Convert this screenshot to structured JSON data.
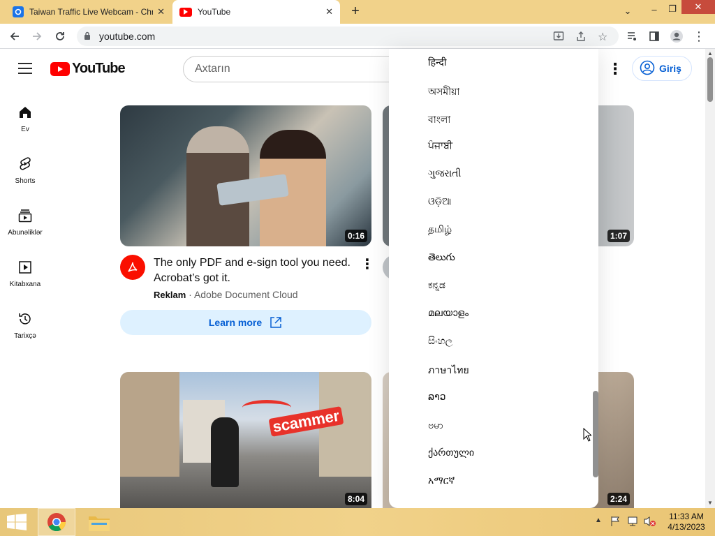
{
  "browser": {
    "tabs": [
      {
        "title": "Taiwan Traffic Live Webcam - Chr",
        "favicon": "webcam-favicon",
        "active": false
      },
      {
        "title": "YouTube",
        "favicon": "youtube-favicon",
        "active": true
      }
    ],
    "new_tab_icon": "plus-icon",
    "window_controls": [
      "chevron-down-icon",
      "minimize-icon",
      "restore-icon",
      "close-icon"
    ],
    "url": "youtube.com",
    "toolbar_icons": [
      "back-icon",
      "forward-icon",
      "reload-icon",
      "lock-icon",
      "install-icon",
      "share-icon",
      "star-icon",
      "media-icon",
      "sidepanel-icon",
      "profile-icon",
      "menu-icon"
    ]
  },
  "youtube": {
    "logo_text": "YouTube",
    "search_placeholder": "Axtarın",
    "signin_label": "Giriş",
    "sidebar": [
      {
        "label": "Ev",
        "icon": "home-icon"
      },
      {
        "label": "Shorts",
        "icon": "shorts-icon"
      },
      {
        "label": "Abunəliklər",
        "icon": "subscriptions-icon"
      },
      {
        "label": "Kitabxana",
        "icon": "library-icon"
      },
      {
        "label": "Tarixçə",
        "icon": "history-icon"
      }
    ],
    "ad": {
      "duration": "0:16",
      "title_line1": "The only PDF and e-sign tool you need.",
      "title_line2": "Acrobat’s got it.",
      "sponsor_tag": "Reklam",
      "separator": "·",
      "channel": "Adobe Document Cloud",
      "cta": "Learn more"
    },
    "video2": {
      "duration": "1:07"
    },
    "video3": {
      "duration": "8:04",
      "overlay_text": "scammer"
    },
    "video4": {
      "duration": "2:24"
    }
  },
  "language_menu": {
    "items": [
      "हिन्दी",
      "অসমীয়া",
      "বাংলা",
      "ਪੰਜਾਬੀ",
      "ગુજરાતી",
      "ଓଡ଼ିଆ",
      "தமிழ்",
      "తెలుగు",
      "ಕನ್ನಡ",
      "മലയാളം",
      "සිංහල",
      "ภาษาไทย",
      "ລາວ",
      "ဗမာ",
      "ქართული",
      "አማርኛ"
    ]
  },
  "taskbar": {
    "time": "11:33 AM",
    "date": "4/13/2023",
    "apps": [
      "windows-start-icon",
      "chrome-icon",
      "file-explorer-icon"
    ]
  },
  "colors": {
    "taskbar": "#f1d28a",
    "youtube_red": "#ff0000",
    "link_blue": "#065fd4",
    "adobe_red": "#fa0f00"
  }
}
